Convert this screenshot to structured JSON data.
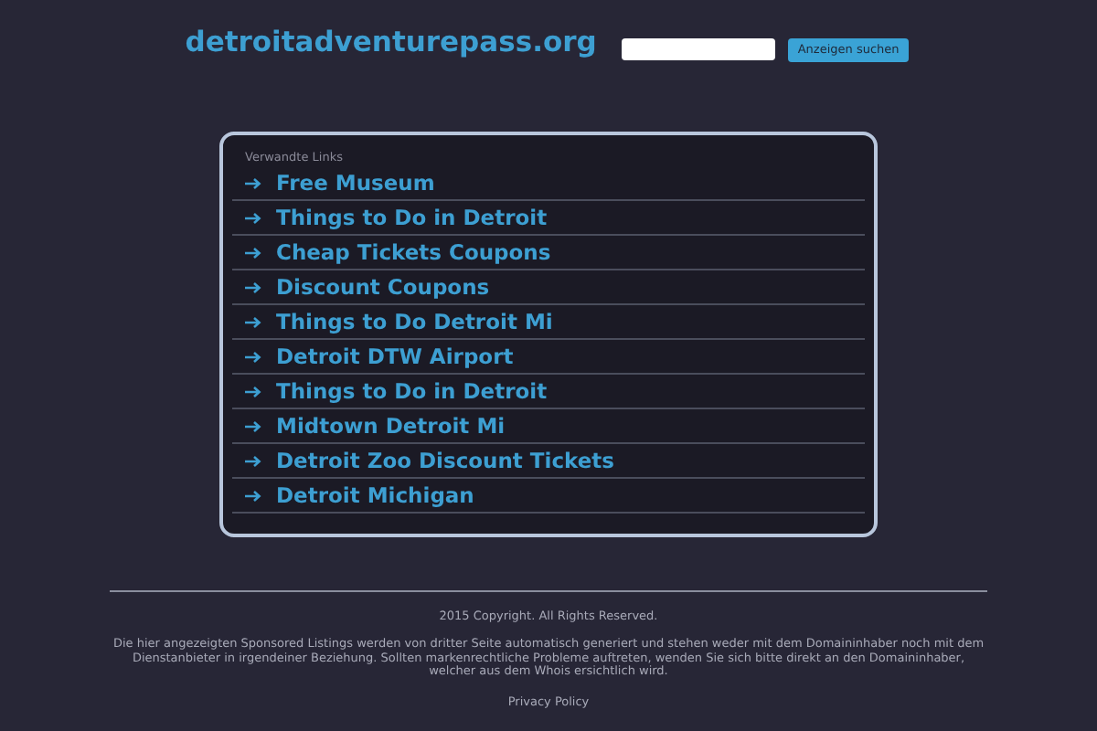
{
  "header": {
    "site_title": "detroitadventurepass.org",
    "search_button": "Anzeigen suchen"
  },
  "links_panel": {
    "heading": "Verwandte Links",
    "links": [
      "Free Museum",
      "Things to Do in Detroit",
      "Cheap Tickets Coupons",
      "Discount Coupons",
      "Things to Do Detroit Mi",
      "Detroit DTW Airport",
      "Things to Do in Detroit",
      "Midtown Detroit Mi",
      "Detroit Zoo Discount Tickets",
      "Detroit Michigan"
    ]
  },
  "footer": {
    "copyright": "2015 Copyright. All Rights Reserved.",
    "disclaimer": "Die hier angezeigten Sponsored Listings werden von dritter Seite automatisch generiert und stehen weder mit dem Domaininhaber noch mit dem Dienstanbieter in irgendeiner Beziehung. Sollten markenrechtliche Probleme auftreten, wenden Sie sich bitte direkt an den Domaininhaber, welcher aus dem Whois ersichtlich wird.",
    "privacy_link": "Privacy Policy"
  }
}
